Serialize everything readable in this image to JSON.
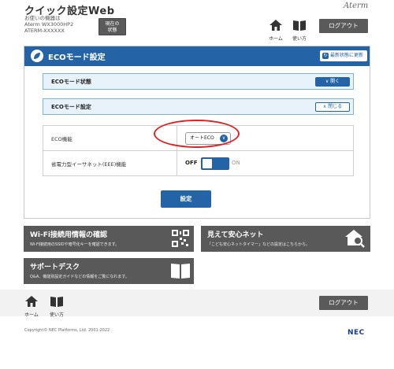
{
  "header": {
    "app_title": "クイック設定Web",
    "device_line1": "お使いの機器は",
    "device_line2": "Aterm WX3000HP2",
    "device_line3": "ATERM-XXXXXX",
    "status_button_line1": "現在の",
    "status_button_line2": "状態",
    "brand": "Aterm",
    "home_label": "ホーム",
    "help_label": "使い方",
    "logout_label": "ログアウト"
  },
  "card": {
    "title": "ECOモード設定",
    "refresh_label": "最新状態に更新",
    "status_section": {
      "label": "ECOモード状態",
      "toggle_label": "開く"
    },
    "settings_section": {
      "label": "ECOモード設定",
      "toggle_label": "閉じる"
    },
    "rows": [
      {
        "label": "ECO機能",
        "value": "オートECO"
      },
      {
        "label": "省電力型イーサネット(EEE)機能",
        "off_label": "OFF",
        "on_label": "ON"
      }
    ],
    "apply_label": "設定"
  },
  "tiles": {
    "wifi": {
      "title": "Wi-Fi接続用情報の確認",
      "subtitle": "Wi-Fi接続用のSSIDや暗号化キーを確認できます。"
    },
    "mieru": {
      "title": "見えて安心ネット",
      "subtitle": "「こども安心ネットタイマー」などの設定はこちらから。"
    },
    "support": {
      "title": "サポートデスク",
      "subtitle": "Q&A、機能別設定ガイドなどの情報をご覧になれます。"
    }
  },
  "footer": {
    "home_label": "ホーム",
    "help_label": "使い方",
    "logout_label": "ログアウト",
    "copyright": "Copyright© NEC Platforms, Ltd. 2001-2022",
    "logo": "NEC"
  },
  "colors": {
    "primary_blue": "#2464a6",
    "tile_gray": "#595959",
    "highlight_red": "#e22222"
  }
}
